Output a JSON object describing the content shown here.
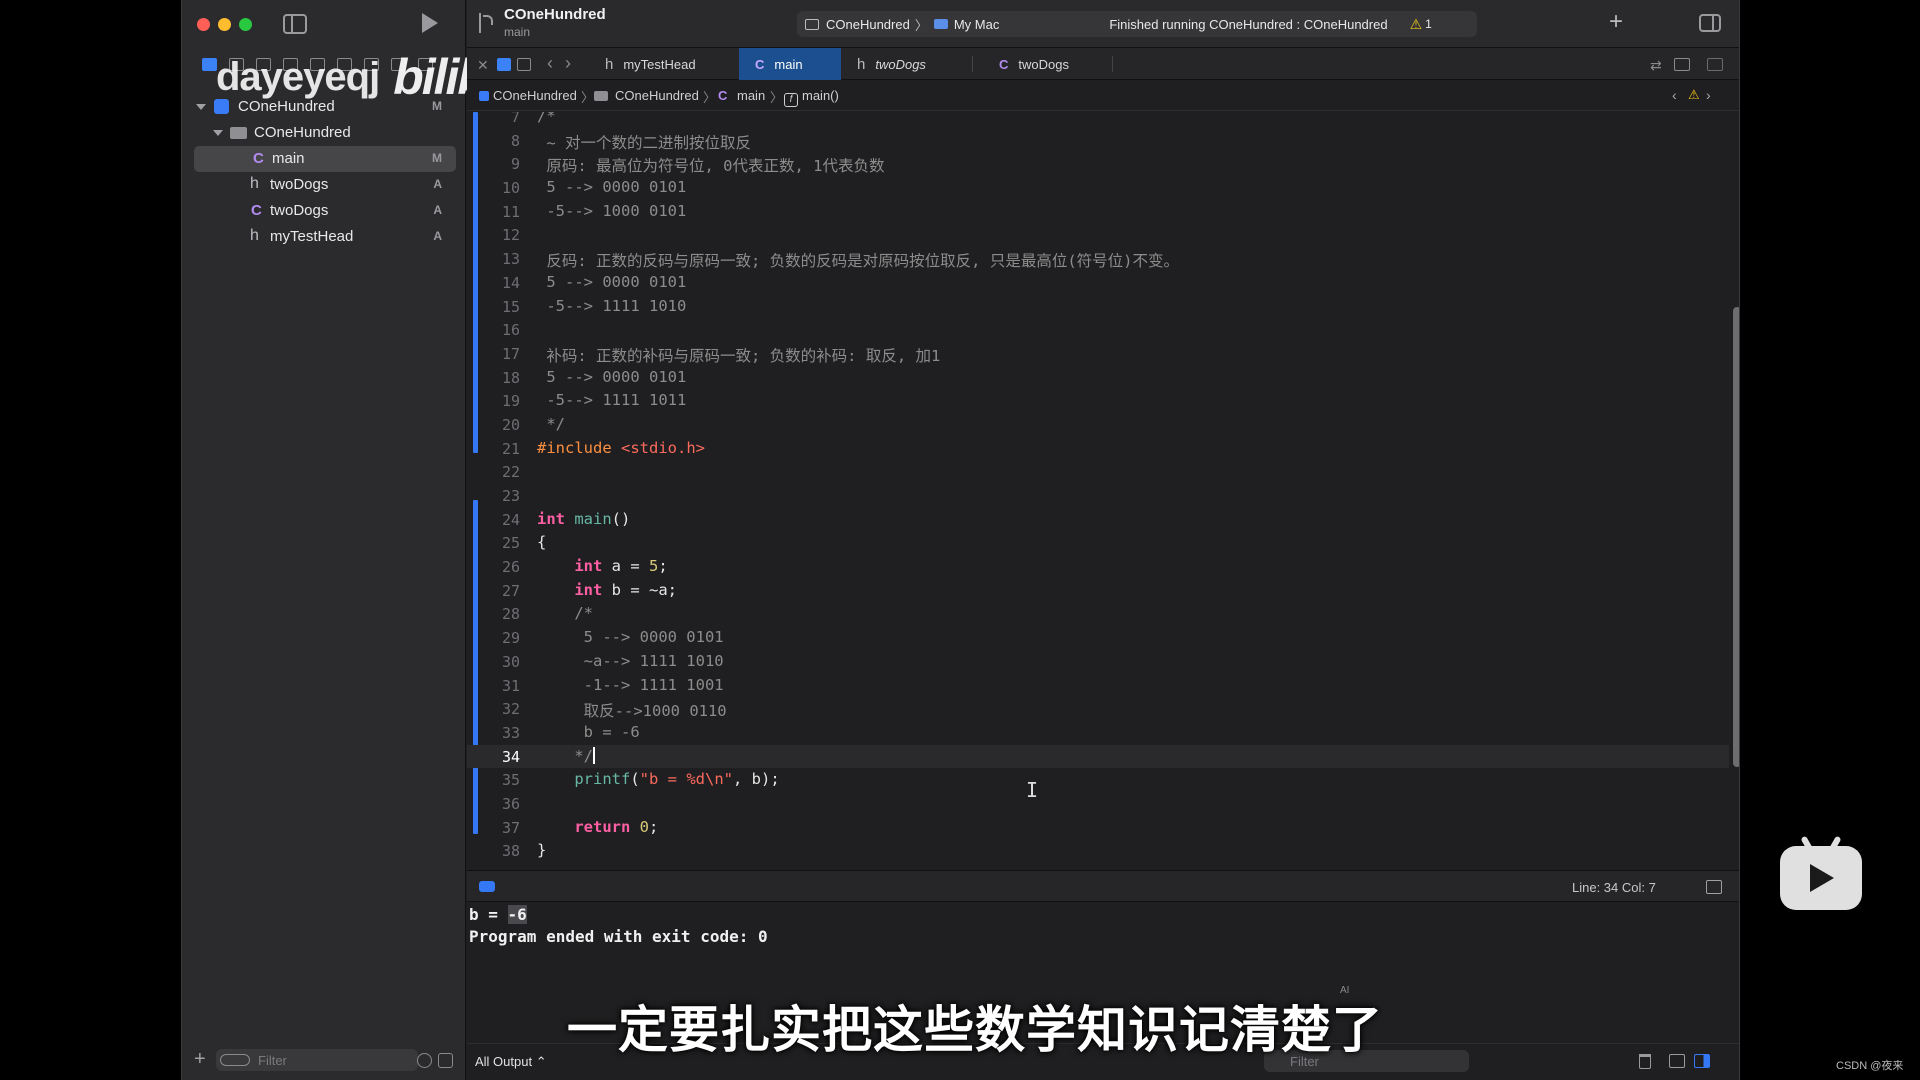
{
  "window": {
    "project_title": "COneHundred",
    "branch": "main",
    "scheme_name": "COneHundred",
    "scheme_chevron": "〉",
    "destination": "My Mac",
    "status_text": "Finished running COneHundred : COneHundred",
    "warning_icon": "⚠",
    "warning_count": "1",
    "add_symbol": "+"
  },
  "watermark": {
    "user": "dayeyeqj",
    "logo": "bilibili"
  },
  "navigator": {
    "items": [
      {
        "label": "COneHundred",
        "kind": "project",
        "badge": "M"
      },
      {
        "label": "COneHundred",
        "kind": "folder",
        "badge": ""
      },
      {
        "label": "main",
        "kind": "c",
        "icon_letter": "C",
        "badge": "M"
      },
      {
        "label": "twoDogs",
        "kind": "h",
        "icon_letter": "h",
        "badge": "A"
      },
      {
        "label": "twoDogs",
        "kind": "c",
        "icon_letter": "C",
        "badge": "A"
      },
      {
        "label": "myTestHead",
        "kind": "h",
        "icon_letter": "h",
        "badge": "A"
      }
    ],
    "filter_placeholder": "Filter",
    "add_symbol": "+"
  },
  "tabs": [
    {
      "icon": "h",
      "label": "myTestHead"
    },
    {
      "icon": "C",
      "label": "main"
    },
    {
      "icon": "h",
      "label": "twoDogs"
    },
    {
      "icon": "C",
      "label": "twoDogs"
    }
  ],
  "tabbar_icons": {
    "close": "✕",
    "back": "‹",
    "forward": "›"
  },
  "jumpbar": {
    "project": "COneHundred",
    "folder": "COneHundred",
    "file_icon": "C",
    "file": "main",
    "func_icon": "f",
    "func": "main()",
    "sep": "〉",
    "prev": "‹",
    "warn": "⚠",
    "next": "›"
  },
  "editor": {
    "current_line": "34",
    "lines": [
      {
        "n": "7",
        "parts": [
          [
            "cm",
            "/*"
          ]
        ]
      },
      {
        "n": "8",
        "parts": [
          [
            "cm",
            " ~ 对一个数的二进制按位取反"
          ]
        ]
      },
      {
        "n": "9",
        "parts": [
          [
            "cm",
            " 原码: 最高位为符号位, 0代表正数, 1代表负数"
          ]
        ]
      },
      {
        "n": "10",
        "parts": [
          [
            "cm",
            " 5 --> 0000 0101"
          ]
        ]
      },
      {
        "n": "11",
        "parts": [
          [
            "cm",
            " -5--> 1000 0101"
          ]
        ]
      },
      {
        "n": "12",
        "parts": [
          [
            "cm",
            ""
          ]
        ]
      },
      {
        "n": "13",
        "parts": [
          [
            "cm",
            " 反码: 正数的反码与原码一致; 负数的反码是对原码按位取反, 只是最高位(符号位)不变。"
          ]
        ]
      },
      {
        "n": "14",
        "parts": [
          [
            "cm",
            " 5 --> 0000 0101"
          ]
        ]
      },
      {
        "n": "15",
        "parts": [
          [
            "cm",
            " -5--> 1111 1010"
          ]
        ]
      },
      {
        "n": "16",
        "parts": [
          [
            "cm",
            ""
          ]
        ]
      },
      {
        "n": "17",
        "parts": [
          [
            "cm",
            " 补码: 正数的补码与原码一致; 负数的补码: 取反, 加1"
          ]
        ]
      },
      {
        "n": "18",
        "parts": [
          [
            "cm",
            " 5 --> 0000 0101"
          ]
        ]
      },
      {
        "n": "19",
        "parts": [
          [
            "cm",
            " -5--> 1111 1011"
          ]
        ]
      },
      {
        "n": "20",
        "parts": [
          [
            "cm",
            " */"
          ]
        ]
      },
      {
        "n": "21",
        "parts": [
          [
            "pp",
            "#include "
          ],
          [
            "str",
            "<stdio.h>"
          ]
        ]
      },
      {
        "n": "22",
        "parts": [
          [
            "plain",
            ""
          ]
        ]
      },
      {
        "n": "23",
        "parts": [
          [
            "plain",
            ""
          ]
        ]
      },
      {
        "n": "24",
        "parts": [
          [
            "kw",
            "int"
          ],
          [
            "plain",
            " "
          ],
          [
            "fn",
            "main"
          ],
          [
            "plain",
            "()"
          ]
        ]
      },
      {
        "n": "25",
        "parts": [
          [
            "plain",
            "{"
          ]
        ]
      },
      {
        "n": "26",
        "parts": [
          [
            "plain",
            "    "
          ],
          [
            "kw",
            "int"
          ],
          [
            "plain",
            " a = "
          ],
          [
            "num",
            "5"
          ],
          [
            "plain",
            ";"
          ]
        ]
      },
      {
        "n": "27",
        "parts": [
          [
            "plain",
            "    "
          ],
          [
            "kw",
            "int"
          ],
          [
            "plain",
            " b = ~a;"
          ]
        ]
      },
      {
        "n": "28",
        "parts": [
          [
            "cm",
            "    /*"
          ]
        ]
      },
      {
        "n": "29",
        "parts": [
          [
            "cm",
            "     5 --> 0000 0101"
          ]
        ]
      },
      {
        "n": "30",
        "parts": [
          [
            "cm",
            "     ~a--> 1111 1010"
          ]
        ]
      },
      {
        "n": "31",
        "parts": [
          [
            "cm",
            "     -1--> 1111 1001"
          ]
        ]
      },
      {
        "n": "32",
        "parts": [
          [
            "cm",
            "     取反-->1000 0110"
          ]
        ]
      },
      {
        "n": "33",
        "parts": [
          [
            "cm",
            "     b = -6"
          ]
        ]
      },
      {
        "n": "34",
        "parts": [
          [
            "cm",
            "    */"
          ]
        ]
      },
      {
        "n": "35",
        "parts": [
          [
            "plain",
            "    "
          ],
          [
            "fn",
            "printf"
          ],
          [
            "plain",
            "("
          ],
          [
            "str",
            "\"b = %d\\n\""
          ],
          [
            "plain",
            ", b);"
          ]
        ]
      },
      {
        "n": "36",
        "parts": [
          [
            "plain",
            ""
          ]
        ]
      },
      {
        "n": "37",
        "parts": [
          [
            "plain",
            "    "
          ],
          [
            "kw",
            "return"
          ],
          [
            "plain",
            " "
          ],
          [
            "num",
            "0"
          ],
          [
            "plain",
            ";"
          ]
        ]
      },
      {
        "n": "38",
        "parts": [
          [
            "plain",
            "}"
          ]
        ]
      }
    ]
  },
  "debug": {
    "cursor_position": "Line: 34  Col: 7"
  },
  "console": {
    "line1_prefix": "b = ",
    "line1_value": "-6",
    "line2": "Program ended with exit code: 0",
    "output_selector": "All Output ⌃",
    "filter_placeholder": "Filter"
  },
  "overlay": {
    "subtitle": "一定要扎实把这些数学知识记清楚了",
    "ai_mark": "AI",
    "csdn": "CSDN @夜来"
  },
  "colors": {
    "accent": "#3478f6",
    "keyword": "#fc5fa3",
    "preprocessor": "#fd8f3f",
    "string": "#fc6a5d",
    "number": "#d9c97c",
    "function": "#67b7a4",
    "comment": "#8c8c8c",
    "warning": "#f5c518"
  }
}
